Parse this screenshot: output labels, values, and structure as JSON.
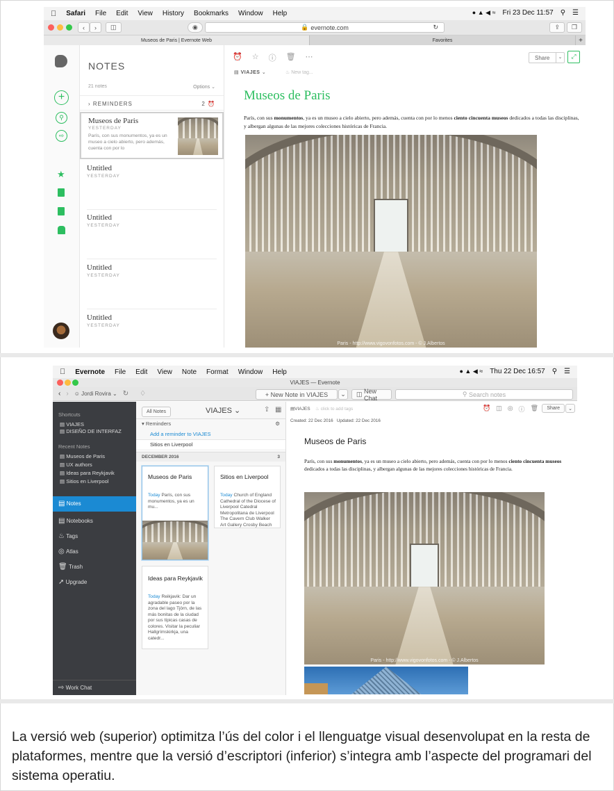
{
  "web": {
    "menubar": {
      "app": "Safari",
      "items": [
        "File",
        "Edit",
        "View",
        "History",
        "Bookmarks",
        "Window",
        "Help"
      ],
      "clock": "Fri 23 Dec 11:57"
    },
    "url": "evernote.com",
    "tabs": [
      "Museos de Paris | Evernote Web",
      "Favorites"
    ],
    "notes_header": "NOTES",
    "notes_count": "21 notes",
    "options": "Options",
    "reminders_label": "REMINDERS",
    "reminders_count": "2",
    "notes": [
      {
        "title": "Museos de Paris",
        "date": "YESTERDAY",
        "snippet": "París, con sus monumentos, ya es un museo a cielo abierto, pero además, cuenta con por lo"
      },
      {
        "title": "Untitled",
        "date": "YESTERDAY"
      },
      {
        "title": "Untitled",
        "date": "YESTERDAY"
      },
      {
        "title": "Untitled",
        "date": "YESTERDAY"
      },
      {
        "title": "Untitled",
        "date": "YESTERDAY"
      }
    ],
    "notebook": "VIAJES",
    "tag_placeholder": "New tag...",
    "share": "Share",
    "note_title": "Museos de Paris",
    "body_a": "París, con sus ",
    "body_b": "monumentos",
    "body_c": ", ya es un museo a cielo abierto, pero además, cuenta con por lo menos ",
    "body_d": "ciento cincuenta museos",
    "body_e": " dedicados a todas las disciplinas, y albergan algunas de las mejores colecciones históricas de Francia.",
    "photo_caption": "Paris - http://www.vigovonfotos.com - © J.Albertos"
  },
  "desktop": {
    "menubar": {
      "app": "Evernote",
      "items": [
        "File",
        "Edit",
        "View",
        "Note",
        "Format",
        "Window",
        "Help"
      ],
      "clock": "Thu 22 Dec 16:57"
    },
    "window_title": "VIAJES — Evernote",
    "user": "Jordi Rovira",
    "new_note": "+ New Note in VIAJES",
    "new_chat": "New Chat",
    "search_placeholder": "Search notes",
    "shortcuts_label": "Shortcuts",
    "shortcuts": [
      "VIAJES",
      "DISEÑO DE INTERFAZ"
    ],
    "recent_label": "Recent Notes",
    "recent": [
      "Museos de Paris",
      "UX authors",
      "Ideas para Reykjavik",
      "Sitios en Liverpool"
    ],
    "nav": [
      "Notes",
      "Notebooks",
      "Tags",
      "Atlas",
      "Trash",
      "Upgrade"
    ],
    "work_chat": "Work Chat",
    "all_notes": "All Notes",
    "notebook_title": "VIAJES",
    "reminders": "Reminders",
    "add_reminder": "Add a reminder to VIAJES",
    "reminder_item": "Sitios en Liverpool",
    "month": "DECEMBER 2016",
    "month_count": "3",
    "cards": [
      {
        "title": "Museos de Paris",
        "today": "Today",
        "text": "París, con sus monumentos, ya es un mu..."
      },
      {
        "title": "Sitios en Liverpool",
        "today": "Today",
        "text": "Church of England Cathedral of the Diocese of Liverpool Catedral Metropolitana de Liverpool The Cavern Club Walker Art Gallery Crosby Beach Tate Liverpool World Museum P..."
      },
      {
        "title": "Ideas para Reykjavik",
        "today": "Today",
        "text": "Reikjavik: Dar un agradable paseo por la zona del lago Tjörn, de las más bonitas de la ciudad por sus típicas casas de colores. Visitar la peculiar Hallgrímskirkja, una catedr..."
      }
    ],
    "notebook_tag": "VIAJES",
    "tag_hint": "click to add tags",
    "share": "Share",
    "created": "Created: 22 Dec 2016",
    "updated": "Updated: 22 Dec 2016",
    "note_title": "Museos de Paris",
    "body_a": "París, con sus ",
    "body_b": "monumentos",
    "body_c": ", ya es un museo a cielo abierto, pero además, cuenta con por lo menos ",
    "body_d": "ciento cincuenta museos",
    "body_e": " dedicados a todas las disciplinas, y albergan algunas de las mejores colecciones históricas de Francia.",
    "photo_caption": "Paris - http://www.vigovonfotos.com - © J.Albertos"
  },
  "caption": "La versió web (superior) optimitza l’ús del color i el llenguatge visual desenvolupat en la resta de plataformes, mentre que la versió d’escriptori (inferior) s’integra amb l’aspecte del programari del sistema operatiu.",
  "colors": {
    "evernote_green": "#2dbe60",
    "mac_blue": "#1b8ad3",
    "sidebar_dark": "#3b3d41"
  }
}
